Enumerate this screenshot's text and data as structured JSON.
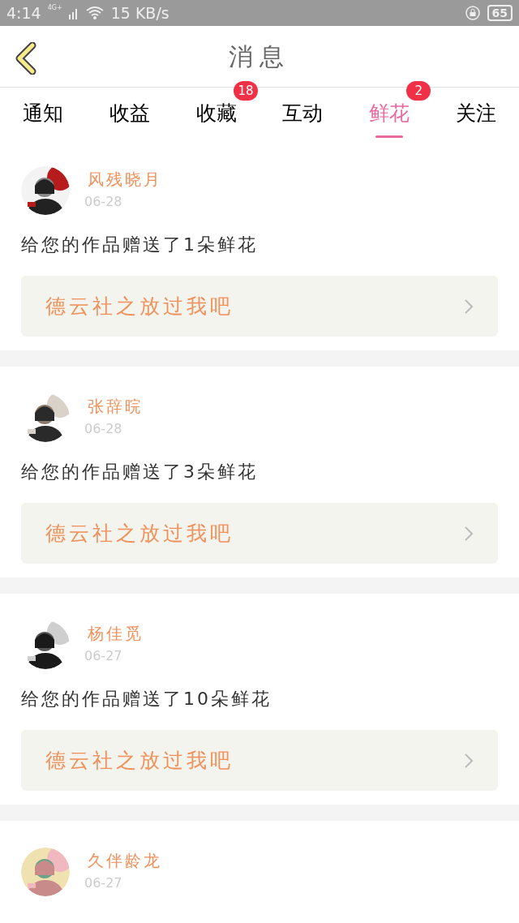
{
  "status_bar": {
    "time": "4:14",
    "network": "4G+",
    "speed": "15 KB/s",
    "battery": "65"
  },
  "header": {
    "title": "消息"
  },
  "tabs": [
    {
      "label": "通知",
      "selected": false
    },
    {
      "label": "收益",
      "selected": false
    },
    {
      "label": "收藏",
      "selected": false,
      "badge": "18"
    },
    {
      "label": "互动",
      "selected": false
    },
    {
      "label": "鲜花",
      "selected": true,
      "badge": "2"
    },
    {
      "label": "关注",
      "selected": false
    }
  ],
  "messages": [
    {
      "user": "风残晓月",
      "date": "06-28",
      "text": "给您的作品赠送了1朵鲜花",
      "work": "德云社之放过我吧"
    },
    {
      "user": "张辞晥",
      "date": "06-28",
      "text": "给您的作品赠送了3朵鲜花",
      "work": "德云社之放过我吧"
    },
    {
      "user": "杨佳觅",
      "date": "06-27",
      "text": "给您的作品赠送了10朵鲜花",
      "work": "德云社之放过我吧"
    },
    {
      "user": "久伴龄龙",
      "date": "06-27"
    }
  ]
}
